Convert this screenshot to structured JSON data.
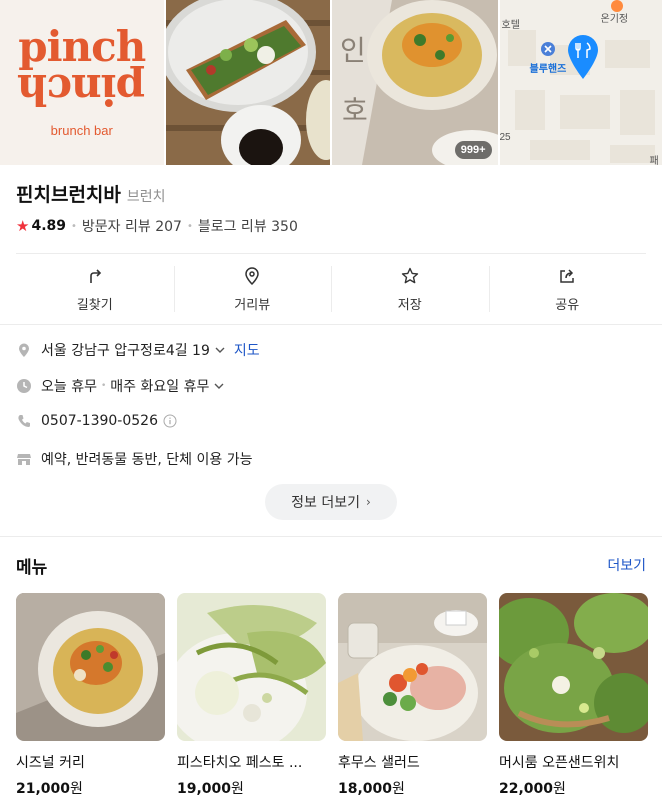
{
  "photos": {
    "logo_text": "pinch",
    "logo_sub": "brunch bar",
    "photo_count": "999+",
    "map": {
      "label_top": "호텔",
      "label_right": "온기정",
      "label_store": "블루핸즈",
      "label_num": "25",
      "label_bottom": "패"
    }
  },
  "place": {
    "name": "핀치브런치바",
    "category": "브런치",
    "rating": "4.89",
    "visitor_reviews": "방문자 리뷰 207",
    "blog_reviews": "블로그 리뷰 350"
  },
  "actions": [
    {
      "label": "길찾기",
      "icon": "directions-icon"
    },
    {
      "label": "거리뷰",
      "icon": "streetview-icon"
    },
    {
      "label": "저장",
      "icon": "star-icon"
    },
    {
      "label": "공유",
      "icon": "share-icon"
    }
  ],
  "info": {
    "address": "서울 강남구 압구정로4길 19",
    "map_link": "지도",
    "hours_today": "오늘 휴무",
    "hours_weekly": "매주 화요일 휴무",
    "phone": "0507-1390-0526",
    "amenities": "예약, 반려동물 동반, 단체 이용 가능",
    "more_info": "정보 더보기"
  },
  "menu": {
    "title": "메뉴",
    "more": "더보기",
    "items": [
      {
        "name": "시즈널 커리",
        "price": "21,000",
        "unit": "원"
      },
      {
        "name": "피스타치오 페스토 ...",
        "price": "19,000",
        "unit": "원"
      },
      {
        "name": "후무스 샐러드",
        "price": "18,000",
        "unit": "원"
      },
      {
        "name": "머시룸 오픈샌드위치",
        "price": "22,000",
        "unit": "원"
      }
    ]
  },
  "colors": {
    "brand_orange": "#e35a30",
    "star_red": "#f0323c",
    "link_blue": "#1e56c7",
    "map_pin_blue": "#1a8cff"
  }
}
